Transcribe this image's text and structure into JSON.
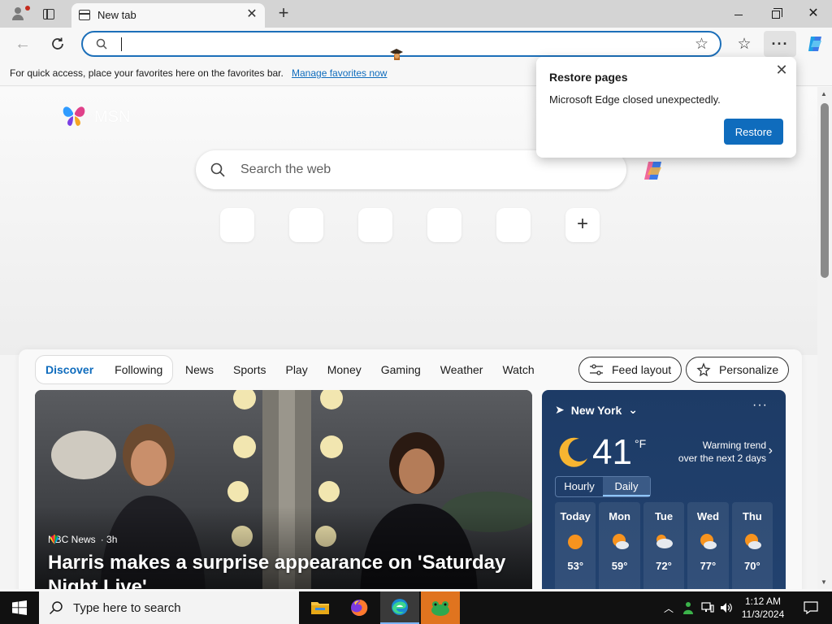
{
  "browser": {
    "tab_title": "New tab",
    "address_value": "",
    "favbar_text": "For quick access, place your favorites here on the favorites bar.",
    "favbar_link": "Manage favorites now",
    "more_label": "···"
  },
  "newtab": {
    "brand_name": "MSN",
    "search_placeholder": "Search the web",
    "quicklinks": [
      "",
      "",
      "",
      "",
      ""
    ],
    "add_label": "+"
  },
  "feed": {
    "segments": [
      "Discover",
      "Following"
    ],
    "nav": [
      "News",
      "Sports",
      "Play",
      "Money",
      "Gaming",
      "Weather",
      "Watch"
    ],
    "feed_layout": "Feed layout",
    "personalize": "Personalize"
  },
  "hero": {
    "source": "NBC News",
    "time": "· 3h",
    "title": "Harris makes a surprise appearance on 'Saturday Night Live'"
  },
  "weather": {
    "location": "New York",
    "temp": "41",
    "unit": "°F",
    "trend_line1": "Warming trend",
    "trend_line2": "over the next 2 days",
    "tabs": [
      "Hourly",
      "Daily"
    ],
    "active_tab": "Daily",
    "days": [
      {
        "name": "Today",
        "hi": "53°",
        "icon": "sun-icon"
      },
      {
        "name": "Mon",
        "hi": "59°",
        "icon": "partly-cloudy-icon"
      },
      {
        "name": "Tue",
        "hi": "72°",
        "icon": "cloudy-icon"
      },
      {
        "name": "Wed",
        "hi": "77°",
        "icon": "partly-cloudy-icon"
      },
      {
        "name": "Thu",
        "hi": "70°",
        "icon": "partly-cloudy-icon"
      }
    ]
  },
  "popup": {
    "title": "Restore pages",
    "text": "Microsoft Edge closed unexpectedly.",
    "button": "Restore"
  },
  "taskbar": {
    "search_placeholder": "Type here to search",
    "time": "1:12 AM",
    "date": "11/3/2024"
  },
  "colors": {
    "accent": "#0f6cbd",
    "address_border": "#1c6fb9",
    "weather_bg": "#1d3b66",
    "taskbar_orange": "#e0741f"
  }
}
